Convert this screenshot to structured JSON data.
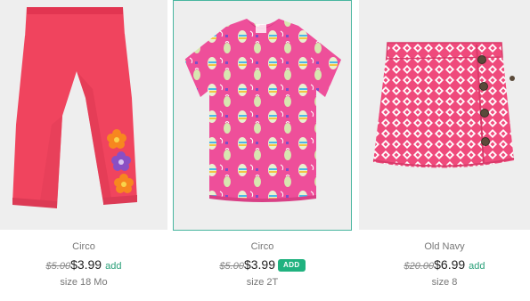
{
  "products": [
    {
      "image": "pink-leggings-with-flowers",
      "brand": "Circo",
      "old_price": "$5.00",
      "price": "$3.99",
      "add_label": "add",
      "size": "size 18 Mo"
    },
    {
      "image": "pink-pear-print-tshirt",
      "brand": "Circo",
      "old_price": "$5.00",
      "price": "$3.99",
      "add_label": "ADD",
      "size": "size 2T"
    },
    {
      "image": "pink-geometric-print-skirt",
      "brand": "Old Navy",
      "old_price": "$20.00",
      "price": "$6.99",
      "add_label": "add",
      "size": "size 8"
    }
  ],
  "colors": {
    "accent": "#20b27f",
    "hover_border": "#48b59f",
    "photo_bg": "#eeeeee"
  }
}
